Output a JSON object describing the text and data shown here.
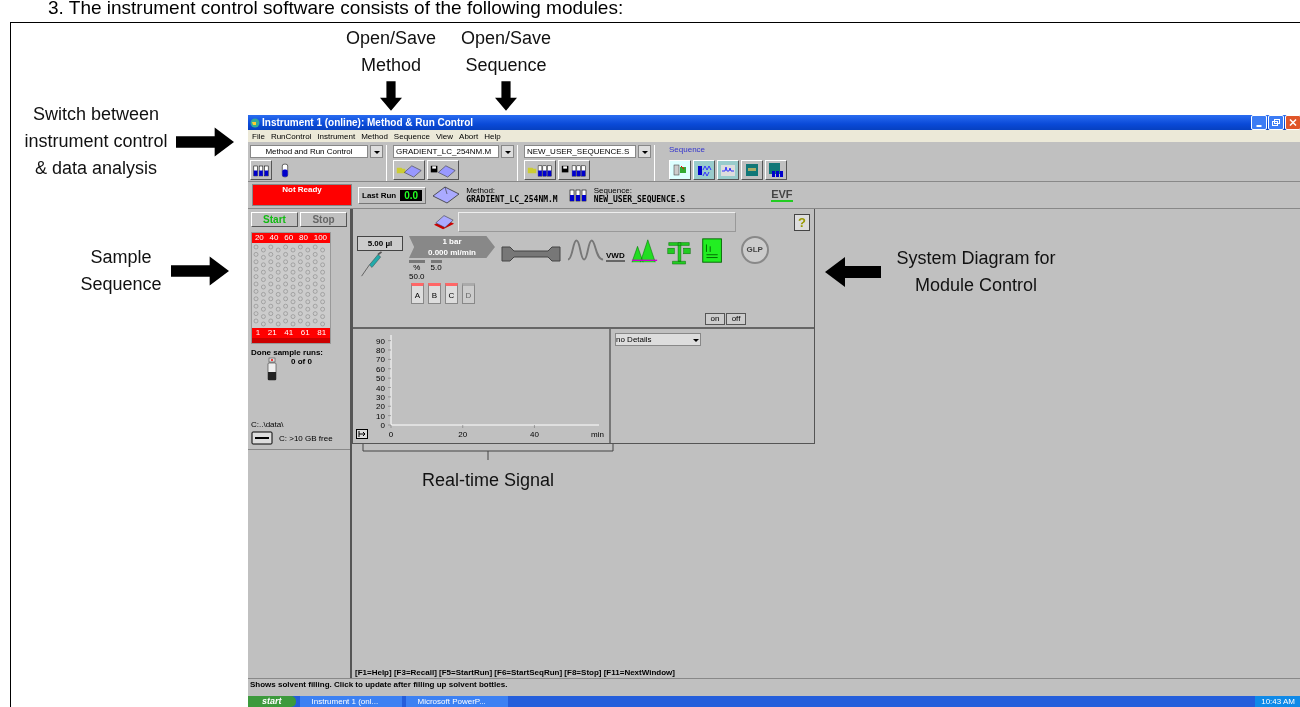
{
  "heading": "3.  The instrument control software consists of the following modules:",
  "callouts": [
    {
      "kind": "arrow-down",
      "text": "Open/Save Method"
    },
    {
      "kind": "arrow-down",
      "text": "Open/Save Sequence"
    },
    {
      "kind": "arrow-right",
      "text": "Switch between instrument control & data analysis"
    },
    {
      "kind": "arrow-right",
      "text": "Sample Sequence"
    },
    {
      "kind": "arrow-left",
      "text": "System Diagram for Module Control"
    },
    {
      "kind": "bracket",
      "text": "Real-time Signal"
    }
  ],
  "window": {
    "title": "Instrument 1 (online): Method & Run Control",
    "menu": [
      "File",
      "RunControl",
      "Instrument",
      "Method",
      "Sequence",
      "View",
      "Abort",
      "Help"
    ],
    "toolbar": {
      "view_select": "Method and Run Control",
      "method_select": "GRADIENT_LC_254NM.M",
      "sequence_select": "NEW_USER_SEQUENCE.S",
      "views_label": "Sequence"
    },
    "status": {
      "state": "Not Ready",
      "last_run_label": "Last Run",
      "last_run": "0.0",
      "method_label": "Method:",
      "method": "GRADIENT_LC_254NM.M",
      "sequence_label": "Sequence:",
      "sequence": "NEW_USER_SEQUENCE.S",
      "logo": "EVF"
    },
    "run_buttons": [
      {
        "label": "Start",
        "disabled": false
      },
      {
        "label": "Stop",
        "disabled": true
      }
    ],
    "tray": {
      "top_labels": [
        "20",
        "40",
        "60",
        "80",
        "100"
      ],
      "bottom_labels": [
        "1",
        "21",
        "41",
        "61",
        "81"
      ]
    },
    "done_runs": {
      "label": "Done sample runs:",
      "value": "0 of 0"
    },
    "disk": {
      "path": "C:..\\data\\",
      "free": "C: >10 GB free"
    },
    "diagram": {
      "help": "?",
      "injector": "5.00 µl",
      "pressure": "1 bar",
      "flow": "0.000 ml/min",
      "mix_label": "%",
      "mix_value": "50.0",
      "flow_value": "5.0",
      "bottles": [
        {
          "label": "A",
          "disabled": false
        },
        {
          "label": "B",
          "disabled": false
        },
        {
          "label": "C",
          "disabled": false
        },
        {
          "label": "D",
          "disabled": true
        }
      ],
      "detector": "VWD",
      "glp": "GLP",
      "switches": [
        "on",
        "off"
      ]
    },
    "chart_data": {
      "type": "line",
      "xlabel": "min",
      "xticks": [
        0,
        20,
        40
      ],
      "yticks": [
        0,
        10,
        20,
        30,
        40,
        50,
        60,
        70,
        80,
        90
      ],
      "xlim": [
        0,
        58
      ],
      "ylim": [
        0,
        96
      ]
    },
    "details_select": "no Details",
    "function_keys": "[F1=Help]  [F3=Recall]  [F5=StartRun]  [F6=StartSeqRun]  [F8=Stop]  [F11=NextWindow]",
    "status_bar": "Shows solvent filling. Click to update after filling up solvent bottles."
  },
  "taskbar": {
    "start": "start",
    "tasks": [
      "Instrument 1 (onl...",
      "Microsoft PowerP..."
    ],
    "clock": "10:43 AM"
  }
}
